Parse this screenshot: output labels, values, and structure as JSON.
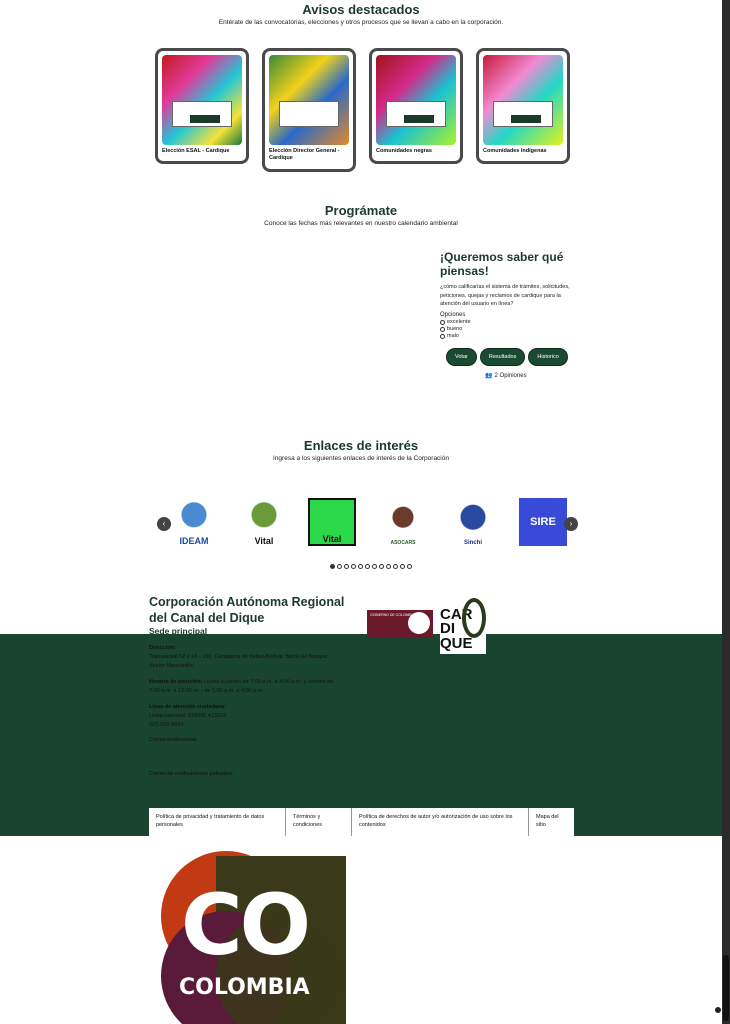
{
  "avisos": {
    "title": "Avisos destacados",
    "subtitle": "Entérate de las convocatorias, elecciones y otros procesos que se llevan a cabo en la corporación.",
    "cards": [
      {
        "label": "Elección ESAL - Cardique"
      },
      {
        "label": "Elección Director General - Cardique"
      },
      {
        "label": "Comunidades negras"
      },
      {
        "label": "Comunidades indígenas"
      }
    ]
  },
  "programate": {
    "title": "Prográmate",
    "subtitle": "Conoce las fechas más relevantes en nuestro calendario ambiental"
  },
  "poll": {
    "title": "¡Queremos saber qué piensas!",
    "question": "¿cómo calificarías el sistema de trámites, solicitudes, peticiones, quejas y reclamos de cardique para la atención del usuario en línea?",
    "options_label": "Opciones",
    "options": [
      "excelente",
      "bueno",
      "malo"
    ],
    "buttons": {
      "vote": "Votar",
      "results": "Resultados",
      "history": "Historico"
    },
    "count": "2 Opiniones"
  },
  "enlaces": {
    "title": "Enlaces de interés",
    "subtitle": "Ingresa a los siguientes enlaces de interés de la Corporación",
    "logos": [
      "IDEAM",
      "Vital",
      "Vital",
      "ASOCARS",
      "Sinchi",
      "SIRE"
    ],
    "arrows": {
      "prev": "‹",
      "next": "›"
    },
    "dot_count": 12
  },
  "footer": {
    "corp_name": "Corporación Autónoma Regional del Canal del Dique",
    "sede": "Sede principal",
    "address_label": "Dirección:",
    "address": "Transversal 52 # 16 - 190, Cartagena de Indias-Bolívar, Barrio El Bosque, Sector Manzanillo",
    "hours_label": "Horario de atención:",
    "hours": "Lunes a jueves de 7:00 a.m. a 4:00 p.m. y viernes de 7:00 a.m. a 12:00 m. - de 1:00 p.m. a 4:00 p.m.",
    "line_label": "Línea de atención ciudadana:",
    "line": "Línea nacional: 018000 413213",
    "phone": "(57) 605 6694",
    "email_label": "Correo institucional:",
    "notif_label": "Correo de notificaciones judiciales:",
    "gov_logo_text": "GOBIERNO DE COLOMBIA",
    "cardique_logo": "CAR DI QUE",
    "legal_links": [
      "Política de privacidad y tratamiento de datos personales",
      "Términos y condiciones",
      "Política de derechos de autor y/o autorización de uso sobre los contenidos",
      "Mapa del sitio"
    ]
  },
  "colombia_logo": {
    "co": "CO",
    "word": "COLOMBIA"
  }
}
